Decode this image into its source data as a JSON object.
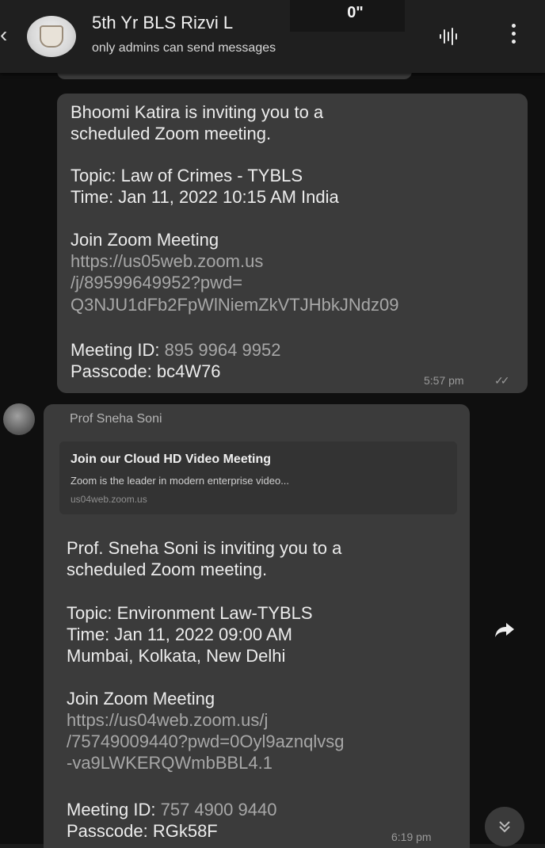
{
  "header": {
    "back_icon": "back-arrow-icon",
    "title": "5th Yr BLS Rizvi L",
    "subtitle": "only admins can send messages",
    "timer": "0\"",
    "audio_icon": "voice-wave-icon",
    "menu_icon": "more-vert-icon"
  },
  "messages": [
    {
      "direction": "outgoing",
      "lines": [
        "Bhoomi Katira is inviting you to a",
        "scheduled Zoom meeting.",
        "",
        "Topic: Law of Crimes - TYBLS",
        "Time: Jan 11, 2022 10:15 AM India",
        "",
        "Join Zoom Meeting"
      ],
      "link_lines": [
        "https://us05web.zoom.us",
        "/j/89599649952?pwd=",
        "Q3NJU1dFb2FpWlNiemZkVTJHbkJNdz09"
      ],
      "meeting_id_label": "Meeting ID: ",
      "meeting_id_value": "895 9964 9952",
      "passcode": "Passcode: bc4W76",
      "time": "5:57 pm",
      "status": "double-tick-icon"
    },
    {
      "direction": "incoming",
      "sender": "Prof Sneha Soni",
      "preview": {
        "title": "Join our Cloud HD Video Meeting",
        "description": "Zoom is the leader in modern enterprise video...",
        "url": "us04web.zoom.us"
      },
      "lines": [
        "Prof. Sneha Soni is inviting you to a",
        "scheduled Zoom meeting.",
        "",
        "Topic: Environment Law-TYBLS",
        "Time: Jan 11, 2022 09:00 AM",
        "Mumbai, Kolkata, New Delhi",
        "",
        "Join Zoom Meeting"
      ],
      "link_lines": [
        "https://us04web.zoom.us/j",
        "/75749009440?pwd=0Oyl9aznqlvsg",
        "-va9LWKERQWmbBBL4.1"
      ],
      "meeting_id_label": "Meeting ID: ",
      "meeting_id_value": "757 4900 9440",
      "passcode": "Passcode: RGk58F",
      "time": "6:19 pm",
      "share_icon": "forward-share-icon"
    }
  ],
  "scroll_down_icon": "double-chevron-down-icon",
  "colors": {
    "background": "#0f0f0f",
    "header": "#1f1f1f",
    "bubble": "#3b3b3b",
    "link": "#a7a7a7"
  }
}
